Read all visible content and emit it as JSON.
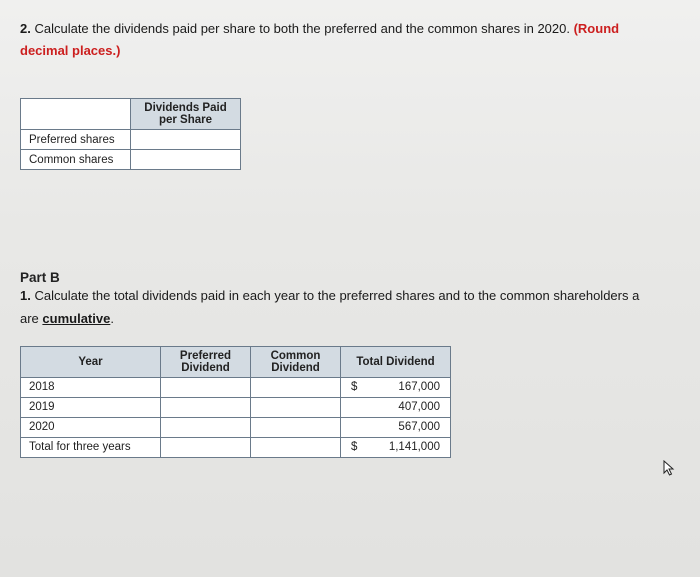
{
  "question2": {
    "number": "2.",
    "text": "Calculate the dividends paid per share to both the preferred and the common shares in 2020. ",
    "round_note_lead": "(Round",
    "round_note_rest": "decimal places.)"
  },
  "table1": {
    "header": "Dividends Paid per Share",
    "rows": [
      "Preferred shares",
      "Common shares"
    ]
  },
  "partB": {
    "heading": "Part B",
    "q1_number": "1.",
    "q1_text_before": "Calculate the total dividends paid in each year to the preferred shares and to the common shareholders a",
    "q1_text_are": "are ",
    "q1_cumulative": "cumulative",
    "q1_period": "."
  },
  "table2": {
    "headers": {
      "year": "Year",
      "preferred": "Preferred Dividend",
      "common": "Common Dividend",
      "total": "Total Dividend"
    },
    "rows": [
      {
        "year": "2018",
        "total_cur": "$",
        "total_amt": "167,000"
      },
      {
        "year": "2019",
        "total_cur": "",
        "total_amt": "407,000"
      },
      {
        "year": "2020",
        "total_cur": "",
        "total_amt": "567,000"
      },
      {
        "year": "Total for three years",
        "total_cur": "$",
        "total_amt": "1,141,000"
      }
    ]
  }
}
